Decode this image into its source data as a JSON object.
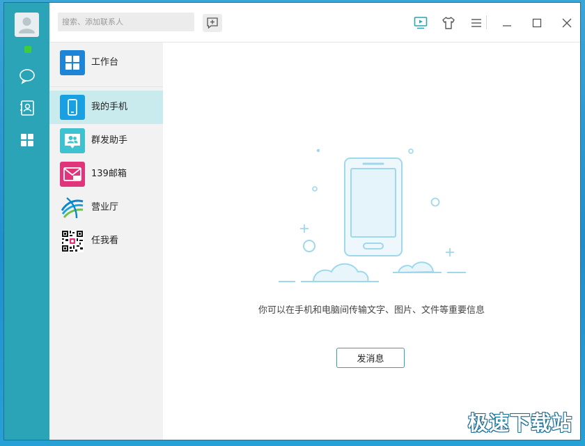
{
  "search": {
    "placeholder": "搜索、添加联系人"
  },
  "sidebar": {
    "items": [
      {
        "label": "工作台",
        "icon": "workbench-icon"
      },
      {
        "label": "我的手机",
        "icon": "phone-icon",
        "selected": true
      },
      {
        "label": "群发助手",
        "icon": "group-send-icon"
      },
      {
        "label": "139邮箱",
        "icon": "mail-139-icon"
      },
      {
        "label": "营业厅",
        "icon": "china-mobile-logo"
      },
      {
        "label": "任我看",
        "icon": "qr-code-icon"
      }
    ]
  },
  "rail": {
    "icons": [
      "avatar",
      "chat-icon",
      "contacts-icon",
      "apps-icon"
    ]
  },
  "toolbar": {
    "icons": [
      "screen-play-icon",
      "skin-shirt-icon",
      "menu-icon",
      "minimize-icon",
      "maximize-icon",
      "close-icon"
    ]
  },
  "main": {
    "hint": "你可以在手机和电脑间传输文字、图片、文件等重要信息",
    "send_label": "发消息"
  },
  "watermark": "极速下载站",
  "colors": {
    "rail": "#2aa4b6",
    "accent": "#2aa4b6",
    "selected": "#c9ebee",
    "illustration": "#9ed8ec"
  }
}
